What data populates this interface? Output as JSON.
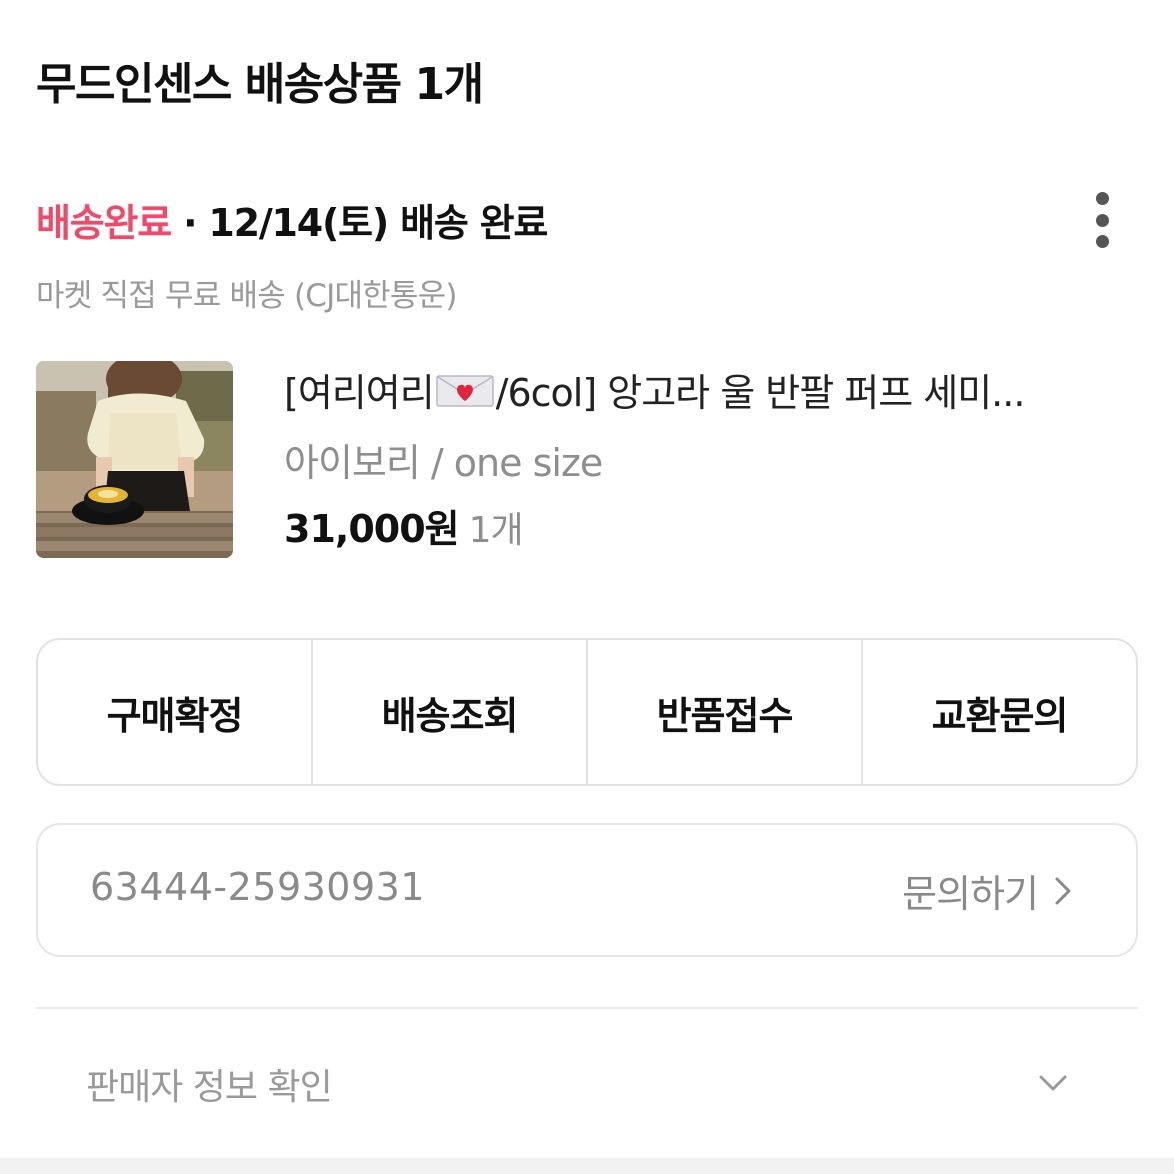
{
  "header": {
    "title": "무드인센스 배송상품 1개"
  },
  "shipment": {
    "status_label": "배송완료",
    "separator": " · ",
    "status_detail": "12/14(토) 배송 완료",
    "delivery_info": "마켓 직접 무료 배송 (CJ대한통운)",
    "more_icon": "more-vertical-icon"
  },
  "product": {
    "name_prefix": "[여리여리",
    "name_icon": "love-letter-icon",
    "name_suffix": "/6col] 앙고라 울 반팔 퍼프 세미...",
    "option": "아이보리 / one size",
    "price": "31,000원",
    "quantity": "1개"
  },
  "actions": [
    {
      "label": "구매확정"
    },
    {
      "label": "배송조회"
    },
    {
      "label": "반품접수"
    },
    {
      "label": "교환문의"
    }
  ],
  "inquiry": {
    "order_number": "63444-25930931",
    "link_label": "문의하기",
    "link_icon": "chevron-right-icon"
  },
  "seller": {
    "label": "판매자 정보 확인",
    "icon": "chevron-down-icon"
  },
  "colors": {
    "status_accent": "#f0496a",
    "text_primary": "#111111",
    "text_secondary": "#8e8e8e",
    "border": "#e2e2e2"
  }
}
